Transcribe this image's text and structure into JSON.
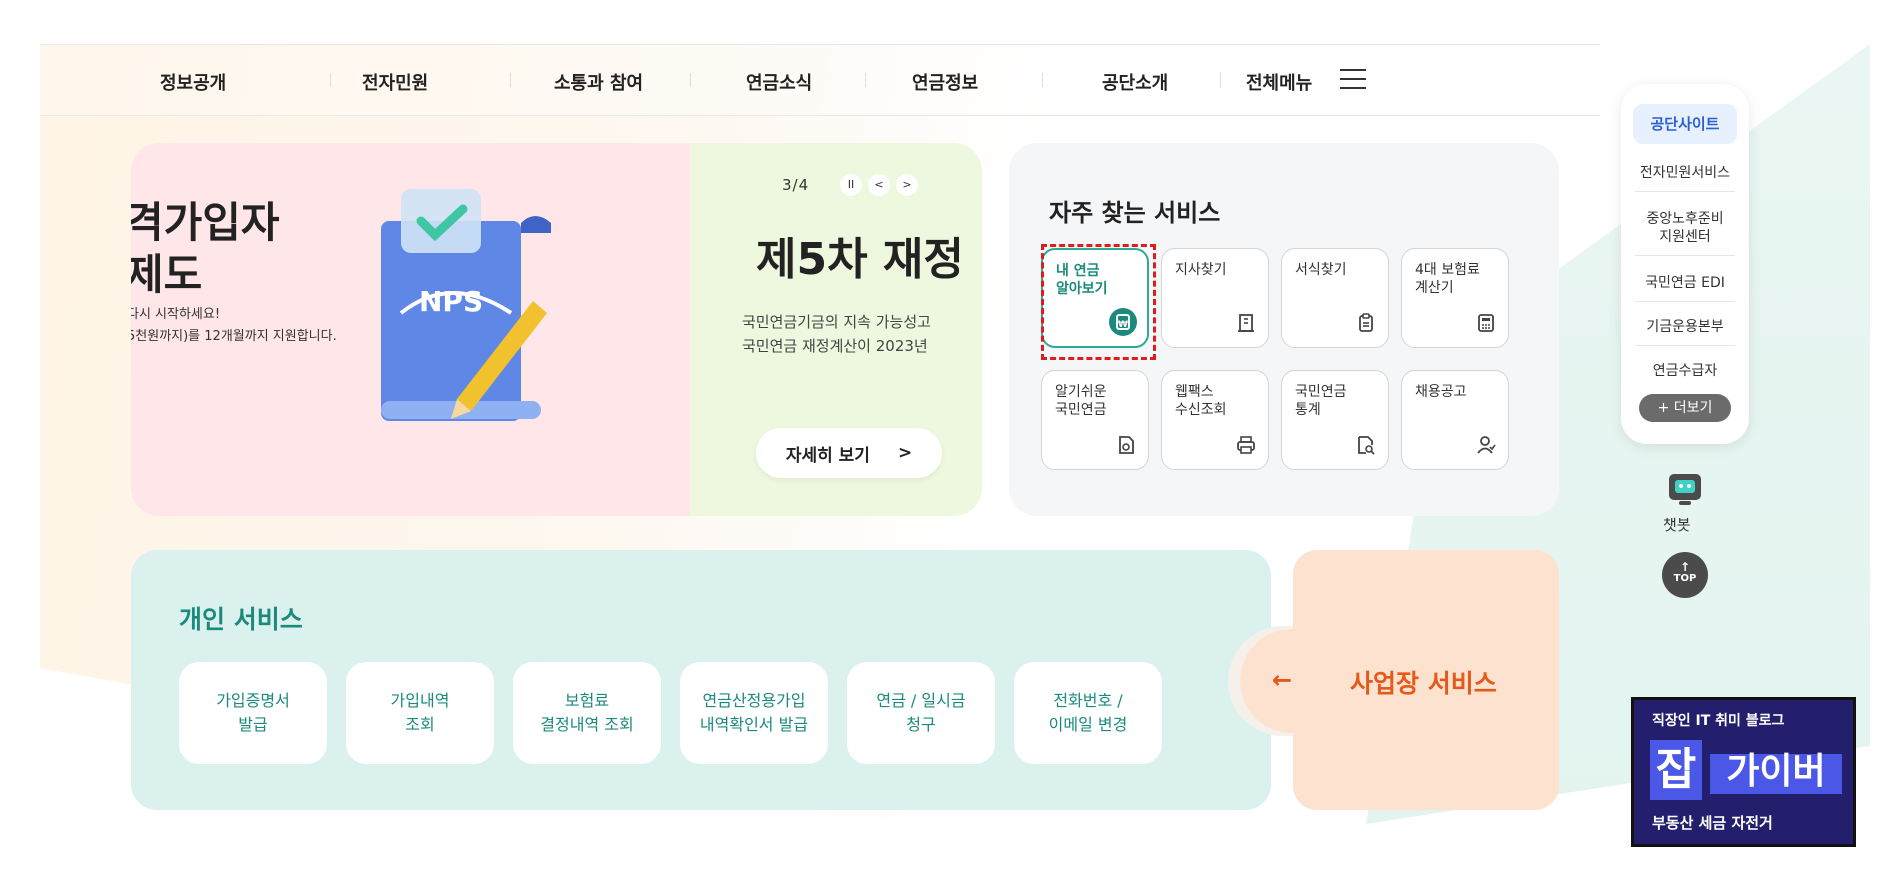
{
  "nav": {
    "items": [
      "정보공개",
      "전자민원",
      "소통과 참여",
      "연금소식",
      "연금정보",
      "공단소개"
    ],
    "all_menu": "전체메뉴"
  },
  "hero": {
    "slide_a": {
      "title_line1": "격가입자",
      "title_line2": "제도",
      "sub_line1": "다시 시작하세요!",
      "sub_line2": "5천원까지)를 12개월까지 지원합니다.",
      "logo_text": "NPS"
    },
    "slide_b": {
      "counter": "3/4",
      "title": "제5차 재정",
      "desc_line1": "국민연금기금의 지속 가능성고",
      "desc_line2": "국민연금 재정계산이 2023년",
      "detail_button": "자세히 보기",
      "detail_arrow": ">"
    },
    "controls": {
      "pause": "II",
      "prev": "<",
      "next": ">"
    }
  },
  "frequent": {
    "title": "자주 찾는 서비스",
    "items": [
      {
        "label": "내 연금\n알아보기",
        "icon": "won-document-icon"
      },
      {
        "label": "지사찾기",
        "icon": "building-icon"
      },
      {
        "label": "서식찾기",
        "icon": "clipboard-icon"
      },
      {
        "label": "4대 보험료\n계산기",
        "icon": "calculator-icon"
      },
      {
        "label": "알기쉬운\n국민연금",
        "icon": "document-icon"
      },
      {
        "label": "웹팩스\n수신조회",
        "icon": "printer-icon"
      },
      {
        "label": "국민연금\n통계",
        "icon": "search-document-icon"
      },
      {
        "label": "채용공고",
        "icon": "person-icon"
      }
    ]
  },
  "personal": {
    "title": "개인 서비스",
    "items": [
      "가입증명서\n발급",
      "가입내역\n조회",
      "보험료\n결정내역 조회",
      "연금산정용가입\n내역확인서 발급",
      "연금 / 일시금\n청구",
      "전화번호 /\n이메일 변경"
    ]
  },
  "business": {
    "arrow": "←",
    "title": "사업장 서비스"
  },
  "sidebar": {
    "head": "공단사이트",
    "items": [
      "전자민원서비스",
      "중앙노후준비\n지원센터",
      "국민연금 EDI",
      "기금운용본부",
      "연금수급자"
    ],
    "more": "+ 더보기",
    "chatbot": "챗봇",
    "top": "TOP"
  },
  "watermark": {
    "top": "직장인 IT 취미 블로그",
    "jab": "잡",
    "gaiber": "가이버",
    "bottom": "부동산 세금 자전거"
  },
  "colors": {
    "accent_teal": "#1b8a7d",
    "accent_orange": "#e35a1a",
    "accent_blue": "#2d5fd1",
    "hero_pink": "#ffe6e8",
    "hero_green": "#eef8de"
  }
}
